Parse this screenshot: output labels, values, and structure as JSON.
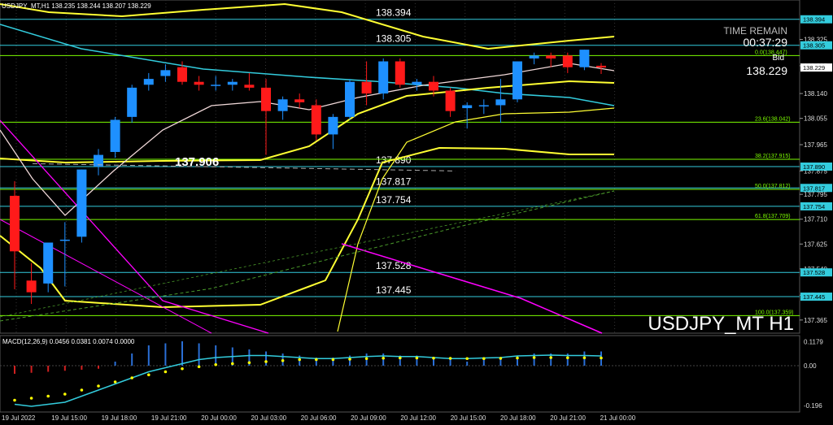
{
  "header": {
    "info": "USDJPY_MT,H1  138.235 138.244 138.207 138.229"
  },
  "timer": {
    "label": "TIME REMAIN",
    "value": "00:37:29"
  },
  "bid": {
    "label": "Bid",
    "value": "138.229"
  },
  "symbol_watermark": "USDJPY_MT H1",
  "macd_label": "MACD(12,26,9) 0.0456 0.0381 0.0074 0.0000",
  "colors": {
    "bull": "#1e90ff",
    "bear": "#ff1a1a",
    "band": "#ffff33",
    "ma_cyan": "#33ccdd",
    "ma_white": "#f0d8d8",
    "fib": "#7cfc00",
    "trend": "#ff00ff",
    "level": "#33ccdd"
  },
  "chart_data": {
    "type": "candlestick",
    "price_axis": {
      "ylim": [
        137.32,
        138.46
      ],
      "ticks": [
        "138.325",
        "138.235",
        "138.140",
        "138.055",
        "137.965",
        "137.875",
        "137.795",
        "137.710",
        "137.625",
        "137.540",
        "137.450",
        "137.365"
      ],
      "current_price": "138.229"
    },
    "time_axis": [
      "19 Jul 2022",
      "19 Jul 15:00",
      "19 Jul 18:00",
      "19 Jul 21:00",
      "20 Jul 00:00",
      "20 Jul 03:00",
      "20 Jul 06:00",
      "20 Jul 09:00",
      "20 Jul 12:00",
      "20 Jul 15:00",
      "20 Jul 18:00",
      "20 Jul 21:00",
      "21 Jul 00:00"
    ],
    "candles": [
      {
        "o": 137.79,
        "h": 137.84,
        "c": 137.6,
        "l": 137.47
      },
      {
        "o": 137.5,
        "h": 137.56,
        "c": 137.46,
        "l": 137.42
      },
      {
        "o": 137.49,
        "h": 137.62,
        "c": 137.63,
        "l": 137.46
      },
      {
        "o": 137.64,
        "h": 137.7,
        "c": 137.64,
        "l": 137.48
      },
      {
        "o": 137.65,
        "h": 137.88,
        "c": 137.88,
        "l": 137.63
      },
      {
        "o": 137.89,
        "h": 137.95,
        "c": 137.93,
        "l": 137.86
      },
      {
        "o": 137.94,
        "h": 138.06,
        "c": 138.05,
        "l": 137.92
      },
      {
        "o": 138.06,
        "h": 138.17,
        "c": 138.16,
        "l": 138.04
      },
      {
        "o": 138.17,
        "h": 138.21,
        "c": 138.19,
        "l": 138.15
      },
      {
        "o": 138.2,
        "h": 138.24,
        "c": 138.22,
        "l": 138.18
      },
      {
        "o": 138.23,
        "h": 138.25,
        "c": 138.18,
        "l": 138.17
      },
      {
        "o": 138.18,
        "h": 138.2,
        "c": 138.17,
        "l": 138.15
      },
      {
        "o": 138.17,
        "h": 138.2,
        "c": 138.17,
        "l": 138.15
      },
      {
        "o": 138.17,
        "h": 138.19,
        "c": 138.18,
        "l": 138.15
      },
      {
        "o": 138.17,
        "h": 138.21,
        "c": 138.16,
        "l": 138.15
      },
      {
        "o": 138.16,
        "h": 138.19,
        "c": 138.08,
        "l": 137.93
      },
      {
        "o": 138.08,
        "h": 138.13,
        "c": 138.12,
        "l": 138.05
      },
      {
        "o": 138.12,
        "h": 138.14,
        "c": 138.11,
        "l": 138.09
      },
      {
        "o": 138.1,
        "h": 138.12,
        "c": 138.0,
        "l": 137.98
      },
      {
        "o": 138.0,
        "h": 138.07,
        "c": 138.06,
        "l": 137.95
      },
      {
        "o": 138.06,
        "h": 138.19,
        "c": 138.18,
        "l": 138.05
      },
      {
        "o": 138.18,
        "h": 138.25,
        "c": 138.14,
        "l": 138.1
      },
      {
        "o": 138.14,
        "h": 138.26,
        "c": 138.25,
        "l": 138.12
      },
      {
        "o": 138.25,
        "h": 138.26,
        "c": 138.17,
        "l": 138.16
      },
      {
        "o": 138.17,
        "h": 138.19,
        "c": 138.18,
        "l": 138.15
      },
      {
        "o": 138.18,
        "h": 138.2,
        "c": 138.15,
        "l": 138.13
      },
      {
        "o": 138.15,
        "h": 138.16,
        "c": 138.08,
        "l": 138.06
      },
      {
        "o": 138.09,
        "h": 138.11,
        "c": 138.1,
        "l": 138.02
      },
      {
        "o": 138.1,
        "h": 138.12,
        "c": 138.1,
        "l": 138.07
      },
      {
        "o": 138.1,
        "h": 138.19,
        "c": 138.12,
        "l": 138.04
      },
      {
        "o": 138.12,
        "h": 138.25,
        "c": 138.25,
        "l": 138.11
      },
      {
        "o": 138.26,
        "h": 138.28,
        "c": 138.27,
        "l": 138.24
      },
      {
        "o": 138.27,
        "h": 138.28,
        "c": 138.26,
        "l": 138.23
      },
      {
        "o": 138.27,
        "h": 138.28,
        "c": 138.23,
        "l": 138.21
      },
      {
        "o": 138.23,
        "h": 138.29,
        "c": 138.29,
        "l": 138.22
      },
      {
        "o": 138.235,
        "h": 138.244,
        "c": 138.229,
        "l": 138.207
      }
    ],
    "horizontal_levels": [
      {
        "price": 138.394,
        "label": "138.394",
        "tag": "138.394"
      },
      {
        "price": 138.305,
        "label": "138.305",
        "tag": "138.305"
      },
      {
        "price": 137.89,
        "label": "137.890",
        "tag": "137.890"
      },
      {
        "price": 137.817,
        "label": "137.817",
        "tag": "137.817"
      },
      {
        "price": 137.754,
        "label": "137.754",
        "tag": "137.754"
      },
      {
        "price": 137.528,
        "label": "137.528",
        "tag": "137.528"
      },
      {
        "price": 137.445,
        "label": "137.445",
        "tag": "137.445"
      }
    ],
    "fib_levels": [
      {
        "price": 138.27,
        "label": "0.0(138.447)"
      },
      {
        "price": 138.042,
        "label": "23.6(138.042)"
      },
      {
        "price": 137.915,
        "label": "38.2(137.915)"
      },
      {
        "price": 137.812,
        "label": "50.0(137.812)"
      },
      {
        "price": 137.709,
        "label": "61.8(137.709)"
      },
      {
        "price": 137.38,
        "label": "100.0(137.359)"
      }
    ],
    "annotation": {
      "price": 137.906,
      "label": "137.906"
    },
    "macd": {
      "ylim": [
        -0.22,
        0.14
      ],
      "ticks": [
        "0.1179",
        "0.00",
        "-0.196"
      ],
      "histogram": [
        -0.04,
        -0.035,
        -0.03,
        -0.025,
        -0.02,
        -0.015,
        0.02,
        0.06,
        0.1,
        0.11,
        0.12,
        0.11,
        0.1,
        0.09,
        0.08,
        0.07,
        0.06,
        0.05,
        0.04,
        0.04,
        0.05,
        0.06,
        0.06,
        0.05,
        0.05,
        0.04,
        0.03,
        0.02,
        0.03,
        0.04,
        0.05,
        0.06,
        0.06,
        0.06,
        0.07,
        0.07
      ],
      "signal": [
        -0.17,
        -0.16,
        -0.15,
        -0.14,
        -0.12,
        -0.1,
        -0.08,
        -0.06,
        -0.045,
        -0.03,
        -0.015,
        -0.005,
        0.005,
        0.01,
        0.015,
        0.02,
        0.025,
        0.03,
        0.03,
        0.03,
        0.032,
        0.035,
        0.037,
        0.038,
        0.038,
        0.037,
        0.036,
        0.035,
        0.035,
        0.036,
        0.038,
        0.04,
        0.04,
        0.039,
        0.039,
        0.038
      ],
      "main": [
        -0.19,
        -0.2,
        -0.19,
        -0.18,
        -0.15,
        -0.12,
        -0.09,
        -0.06,
        -0.03,
        -0.01,
        0.01,
        0.03,
        0.04,
        0.045,
        0.05,
        0.05,
        0.045,
        0.04,
        0.035,
        0.035,
        0.04,
        0.045,
        0.048,
        0.045,
        0.045,
        0.04,
        0.035,
        0.035,
        0.038,
        0.04,
        0.048,
        0.05,
        0.052,
        0.05,
        0.05,
        0.048
      ]
    }
  }
}
